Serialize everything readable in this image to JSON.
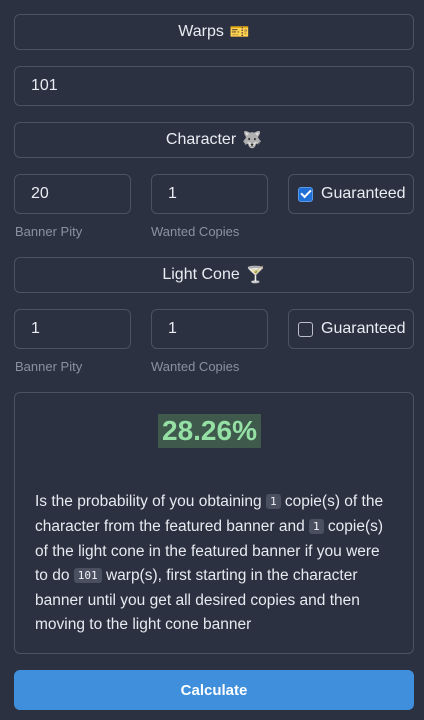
{
  "warps_header": {
    "label": "Warps",
    "emoji": "🎫"
  },
  "warps_input": {
    "value": "101"
  },
  "character": {
    "header_label": "Character",
    "emoji": "🐺",
    "banner_pity": {
      "value": "20",
      "caption": "Banner Pity"
    },
    "wanted_copies": {
      "value": "1",
      "caption": "Wanted Copies"
    },
    "guaranteed": {
      "label": "Guaranteed",
      "checked": true
    }
  },
  "light_cone": {
    "header_label": "Light Cone",
    "emoji": "🍸",
    "banner_pity": {
      "value": "1",
      "caption": "Banner Pity"
    },
    "wanted_copies": {
      "value": "1",
      "caption": "Wanted Copies"
    },
    "guaranteed": {
      "label": "Guaranteed",
      "checked": false
    }
  },
  "result": {
    "percent": "28.26%",
    "text": {
      "t1": "Is the probability of you obtaining ",
      "c1": "1",
      "t2": " copie(s) of the character from the featured banner and ",
      "c2": "1",
      "t3": " copie(s) of the light cone in the featured banner if you were to do ",
      "c3": "101",
      "t4": " warp(s), first starting in the character banner until you get all desired copies and then moving to the light cone banner"
    }
  },
  "calculate_button": {
    "label": "Calculate"
  },
  "colors": {
    "accent": "#3f8fdc",
    "checkbox": "#1f6fd6",
    "percent_text": "#95e0a5",
    "percent_bg": "#3f5a4c"
  }
}
